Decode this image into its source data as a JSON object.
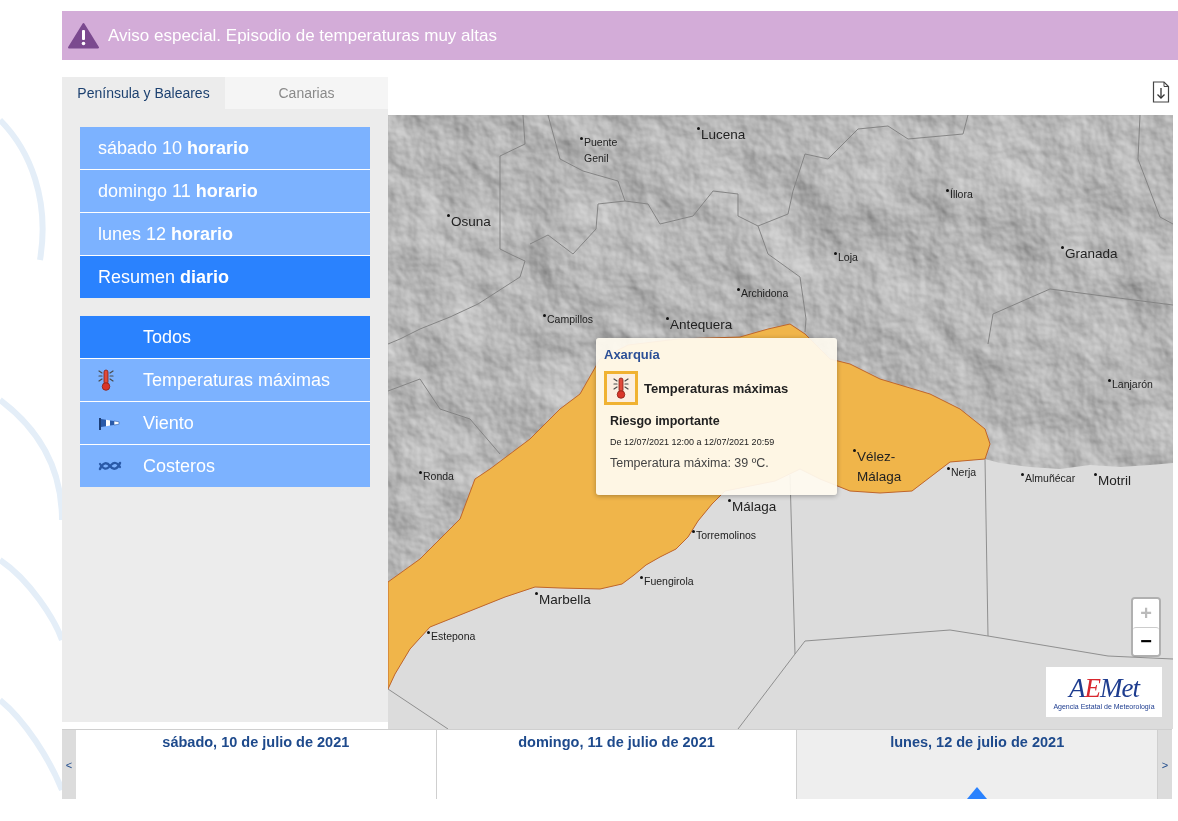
{
  "alert": {
    "text": "Aviso especial. Episodio de temperaturas muy altas"
  },
  "region_tabs": [
    {
      "label": "Península y Baleares",
      "selected": true
    },
    {
      "label": "Canarias",
      "selected": false
    }
  ],
  "day_menu": [
    {
      "label": "sábado 10 **horario**",
      "selected": false
    },
    {
      "label": "domingo 11 **horario**",
      "selected": false
    },
    {
      "label": "lunes 12 **horario**",
      "selected": false
    },
    {
      "label": "Resumen **diario**",
      "selected": true
    }
  ],
  "phenomenon_menu": [
    {
      "label": "Todos",
      "kind": "all",
      "selected": true
    },
    {
      "label": "Temperaturas máximas",
      "kind": "temperature",
      "selected": false
    },
    {
      "label": "Viento",
      "kind": "wind",
      "selected": false
    },
    {
      "label": "Costeros",
      "kind": "coastal",
      "selected": false
    }
  ],
  "map": {
    "places": [
      {
        "name": "Lucena",
        "kind": "city"
      },
      {
        "name": "Puente Genil",
        "kind": "town"
      },
      {
        "name": "Íllora",
        "kind": "town"
      },
      {
        "name": "Osuna",
        "kind": "city"
      },
      {
        "name": "Granada",
        "kind": "city"
      },
      {
        "name": "Loja",
        "kind": "town"
      },
      {
        "name": "Archidona",
        "kind": "town"
      },
      {
        "name": "Campillos",
        "kind": "town"
      },
      {
        "name": "Antequera",
        "kind": "city"
      },
      {
        "name": "Lanjarón",
        "kind": "town"
      },
      {
        "name": "Ronda",
        "kind": "town"
      },
      {
        "name": "Vélez-Málaga",
        "kind": "city"
      },
      {
        "name": "Nerja",
        "kind": "town"
      },
      {
        "name": "Almuñécar",
        "kind": "town"
      },
      {
        "name": "Motril",
        "kind": "city"
      },
      {
        "name": "Málaga",
        "kind": "city"
      },
      {
        "name": "Torremolinos",
        "kind": "town"
      },
      {
        "name": "Fuengirola",
        "kind": "town"
      },
      {
        "name": "Marbella",
        "kind": "city"
      },
      {
        "name": "Estepona",
        "kind": "town"
      }
    ],
    "popup": {
      "zone": "Axarquía",
      "kind": "temperature",
      "phenomenon": "Temperaturas máximas",
      "risk": "Riesgo importante",
      "period": "De 12/07/2021 12:00 a 12/07/2021 20:59",
      "detail": "Temperatura máxima: 39 ºC."
    },
    "zoom_in": {
      "label": "+",
      "disabled": true
    },
    "zoom_out": {
      "label": "−",
      "disabled": false
    },
    "logo": {
      "wordmark": "AEMet",
      "tagline": "Agencia Estatal de Meteorología"
    }
  },
  "date_bar": {
    "prev": "<",
    "next": ">",
    "days": [
      {
        "label": "sábado, 10 de julio de 2021",
        "selected": false
      },
      {
        "label": "domingo, 11 de julio de 2021",
        "selected": false
      },
      {
        "label": "lunes, 12 de julio de 2021",
        "selected": true
      }
    ]
  }
}
